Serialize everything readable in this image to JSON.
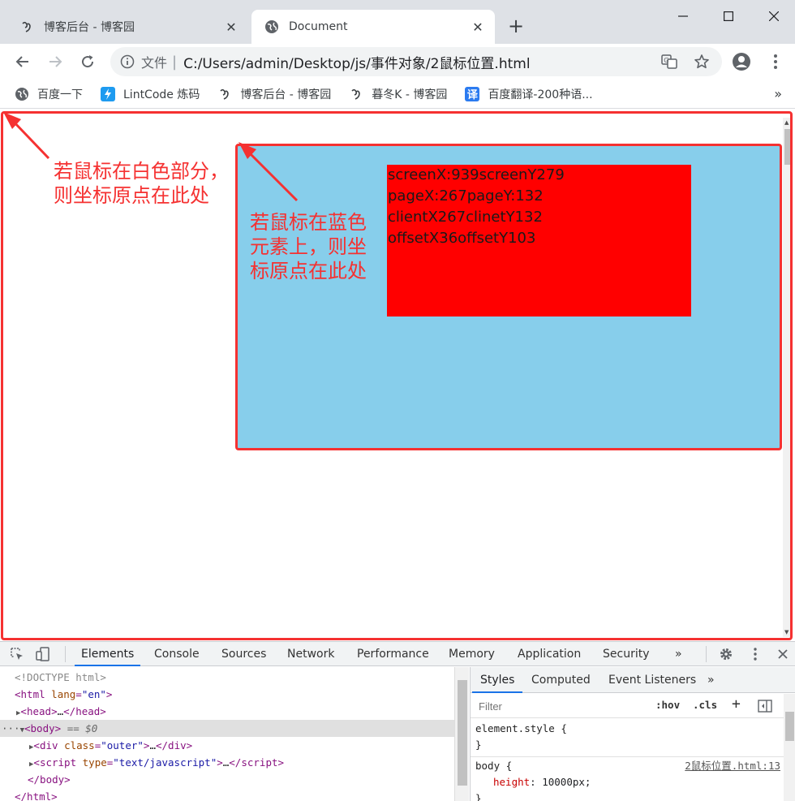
{
  "browser": {
    "tabs": [
      {
        "title": "博客后台 - 博客园",
        "favicon": "cnblogs-icon",
        "active": false
      },
      {
        "title": "Document",
        "favicon": "globe-icon",
        "active": true
      }
    ],
    "new_tab_label": "+",
    "address": {
      "scheme_label": "文件",
      "separator": "|",
      "url": "C:/Users/admin/Desktop/js/事件对象/2鼠标位置.html"
    },
    "bookmarks": [
      {
        "label": "百度一下",
        "icon": "globe-icon"
      },
      {
        "label": "LintCode 炼码",
        "icon": "lintcode-icon"
      },
      {
        "label": "博客后台 - 博客园",
        "icon": "cnblogs-icon"
      },
      {
        "label": "暮冬K - 博客园",
        "icon": "cnblogs-icon"
      },
      {
        "label": "百度翻译-200种语...",
        "icon": "baidu-translate-icon"
      }
    ],
    "bookmarks_overflow": "»",
    "translate_badge": "译"
  },
  "page": {
    "mouse_info": {
      "line1": "screenX:939screenY279",
      "line2": "pageX:267pageY:132",
      "line3": "clientX267clinetY132",
      "line4": "offsetX36offsetY103"
    },
    "annotations": {
      "white_area": "若鼠标在白色部分，则坐标原点在此处",
      "blue_area": "若鼠标在蓝色元素上，则坐标原点在此处"
    },
    "colors": {
      "outer_bg": "#87ceeb",
      "inner_bg": "#ff0000",
      "annotation": "#f53131"
    }
  },
  "devtools": {
    "tabs": [
      "Elements",
      "Console",
      "Sources",
      "Network",
      "Performance",
      "Memory",
      "Application",
      "Security"
    ],
    "active_tab": "Elements",
    "overflow": "»",
    "dom": {
      "doctype": "<!DOCTYPE html>",
      "html_open_tag": "html",
      "html_attr_name": "lang",
      "html_attr_value": "\"en\"",
      "head_collapsed": "head",
      "body_tag": "body",
      "body_marker": "== $0",
      "div_tag": "div",
      "div_attr_name": "class",
      "div_attr_value": "\"outer\"",
      "script_tag": "script",
      "script_attr_name": "type",
      "script_attr_value": "\"text/javascript\"",
      "body_close": "</body>",
      "html_close": "</html>",
      "ellipsis": "…",
      "row_ellipsis": "···"
    },
    "styles": {
      "tabs": [
        "Styles",
        "Computed",
        "Event Listeners"
      ],
      "active_tab": "Styles",
      "overflow": "»",
      "filter_placeholder": "Filter",
      "hov_label": ":hov",
      "cls_label": ".cls",
      "plus_label": "+",
      "rule1_selector": "element.style {",
      "rule1_close": "}",
      "rule2_selector": "body {",
      "rule2_source": "2鼠标位置.html:13",
      "rule2_prop": "height",
      "rule2_value": "10000px;",
      "rule2_close": "}"
    }
  }
}
